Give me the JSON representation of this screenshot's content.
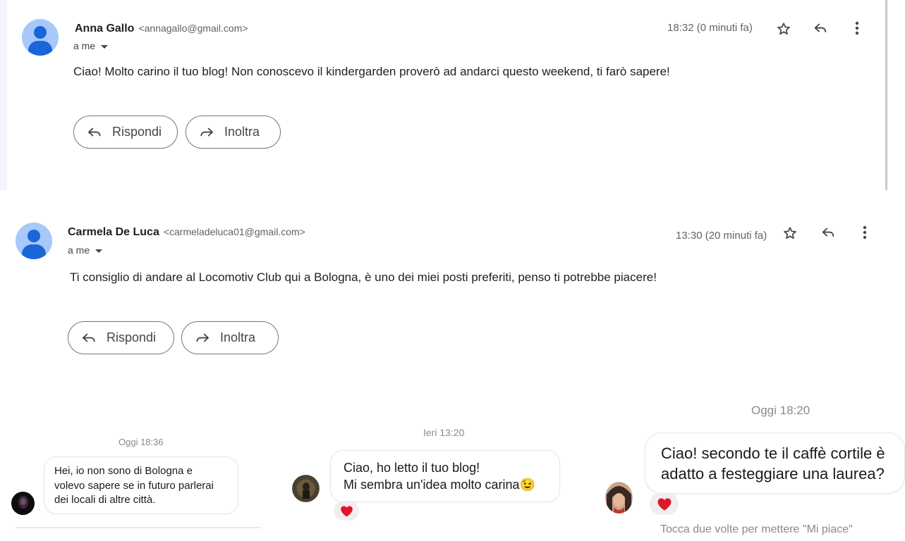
{
  "email1": {
    "sender_name": "Anna Gallo",
    "sender_email": "<annagallo@gmail.com>",
    "to_label": "a me",
    "timestamp": "18:32 (0 minuti fa)",
    "body": "Ciao! Molto carino il tuo blog! Non conoscevo il kindergarden proverò ad andarci questo weekend, ti farò sapere!",
    "reply_label": "Rispondi",
    "forward_label": "Inoltra"
  },
  "email2": {
    "sender_name": "Carmela De Luca",
    "sender_email": "<carmeladeluca01@gmail.com>",
    "to_label": "a me",
    "timestamp": "13:30 (20 minuti fa)",
    "body": "Ti consiglio di andare al Locomotiv Club qui a Bologna, è uno dei miei posti preferiti, penso ti potrebbe piacere!",
    "reply_label": "Rispondi",
    "forward_label": "Inoltra"
  },
  "chat1": {
    "timestamp": "Oggi 18:36",
    "lines": [
      "Hei, io non sono di Bologna e",
      "volevo sapere se in futuro parlerai",
      "dei locali di altre città."
    ]
  },
  "chat2": {
    "timestamp": "Ieri 13:20",
    "lines": [
      "Ciao, ho letto il tuo blog!",
      "Mi sembra un'idea molto carina😉"
    ]
  },
  "chat3": {
    "timestamp": "Oggi 18:20",
    "lines": [
      "Ciao! secondo te il caffè cortile è",
      "adatto a festeggiare una laurea?"
    ],
    "hint": "Tocca due volte per mettere \"Mi piace\""
  },
  "icons": {
    "star": "star-icon",
    "reply": "reply-icon",
    "more": "more-vert-icon",
    "forward": "forward-icon",
    "heart": "heart-icon",
    "caret": "caret-down-icon"
  },
  "colors": {
    "avatar_bg": "#a8c7fa",
    "avatar_fg": "#1a66d8",
    "heart": "#e0162b"
  }
}
